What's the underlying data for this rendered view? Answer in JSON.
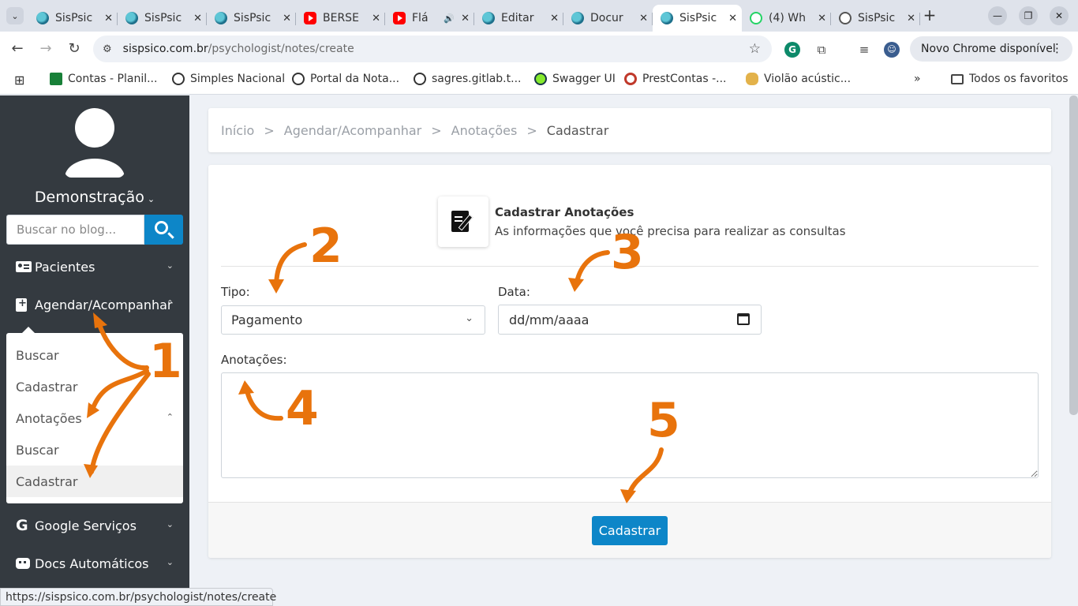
{
  "browser": {
    "tabs": [
      {
        "label": "SisPsic",
        "icon": "brain-favicon"
      },
      {
        "label": "SisPsic",
        "icon": "brain-favicon"
      },
      {
        "label": "SisPsic",
        "icon": "brain-favicon"
      },
      {
        "label": "BERSE",
        "icon": "youtube-favicon"
      },
      {
        "label": "Flá",
        "icon": "youtube-favicon"
      },
      {
        "label": "Editar",
        "icon": "brain-favicon"
      },
      {
        "label": "Docur",
        "icon": "brain-favicon"
      },
      {
        "label": "SisPsic",
        "icon": "brain-favicon",
        "active": true
      },
      {
        "label": "(4) Wh",
        "icon": "whatsapp-favicon"
      },
      {
        "label": "SisPsic",
        "icon": "chatgpt-favicon"
      }
    ],
    "url_host": "sispsico.com.br",
    "url_path": "/psychologist/notes/create",
    "update_label": "Novo Chrome disponível",
    "bookmarks": [
      "Contas - Planil...",
      "Simples Nacional",
      "Portal da Nota...",
      "sagres.gitlab.t...",
      "Swagger UI",
      "PrestContas -...",
      "Violão acústic..."
    ],
    "all_bookmarks": "Todos os favoritos",
    "status_url": "https://sispsico.com.br/psychologist/notes/create"
  },
  "sidebar": {
    "user_name": "Demonstração",
    "search_placeholder": "Buscar no blog...",
    "items": {
      "pacientes": "Pacientes",
      "agendar": "Agendar/Acompanhar",
      "google": "Google Serviços",
      "docs": "Docs Automáticos"
    },
    "submenu": {
      "buscar": "Buscar",
      "cadastrar": "Cadastrar",
      "anotacoes": "Anotações",
      "anot_buscar": "Buscar",
      "anot_cadastrar": "Cadastrar"
    }
  },
  "breadcrumb": [
    "Início",
    "Agendar/Acompanhar",
    "Anotações",
    "Cadastrar"
  ],
  "form": {
    "title": "Cadastrar Anotações",
    "subtitle": "As informações que você precisa para realizar as consultas",
    "tipo_label": "Tipo:",
    "tipo_value": "Pagamento",
    "data_label": "Data:",
    "data_value": "dd/mm/aaaa",
    "anotacoes_label": "Anotações:",
    "submit_label": "Cadastrar"
  },
  "annotations": [
    "1",
    "2",
    "3",
    "4",
    "5"
  ],
  "colors": {
    "accent": "#0d86c8",
    "sidebar": "#343a40",
    "annotation": "#e8730c"
  }
}
